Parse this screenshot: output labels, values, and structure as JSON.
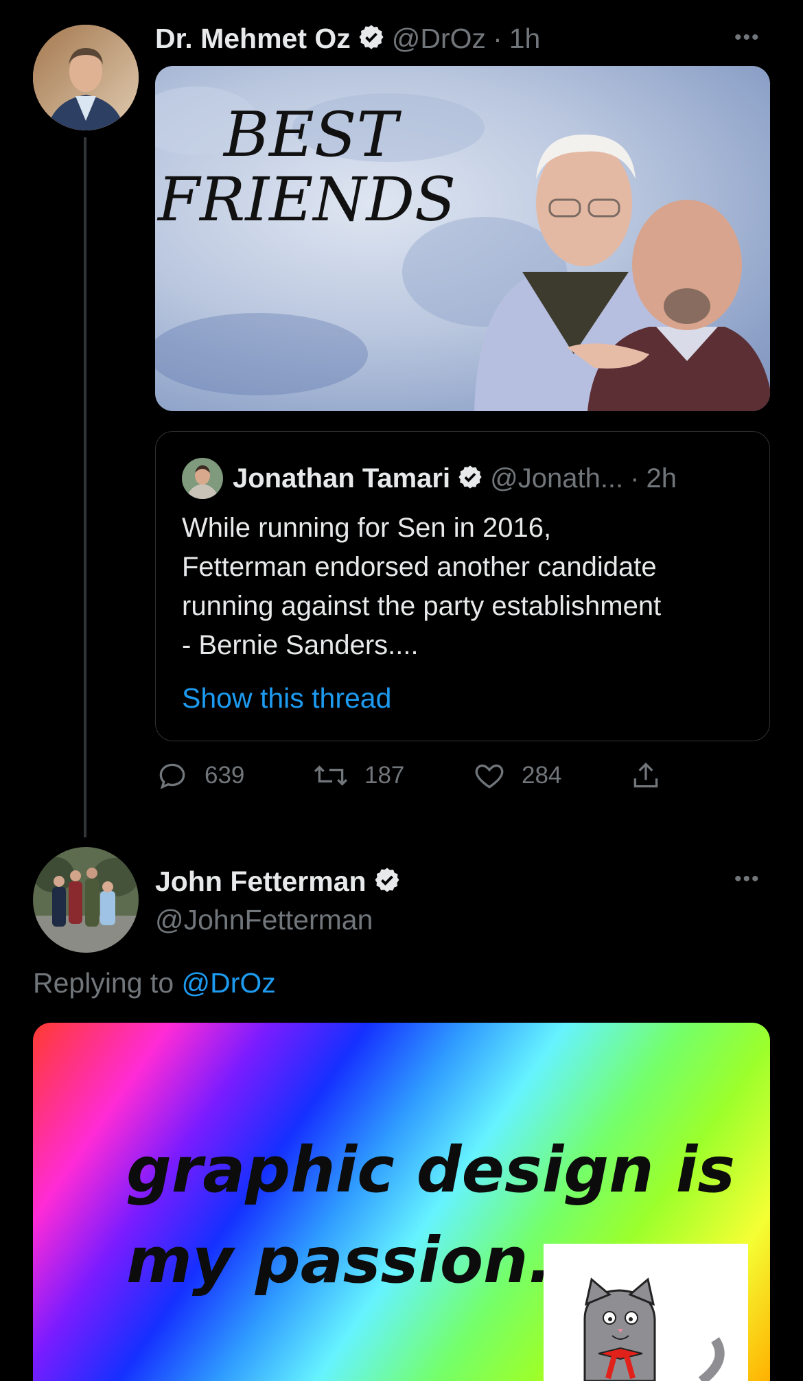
{
  "tweet1": {
    "author_name": "Dr. Mehmet Oz",
    "handle": "@DrOz",
    "separator": "·",
    "time": "1h",
    "more": "•••",
    "image": {
      "title_line1": "BEST",
      "title_line2": "FRIENDS"
    },
    "quote": {
      "author_name": "Jonathan Tamari",
      "handle": "@Jonath...",
      "separator": "·",
      "time": "2h",
      "lines": [
        "While running for Sen in 2016,",
        "Fetterman endorsed another candidate",
        "running against the party establishment",
        "- Bernie Sanders...."
      ],
      "show_thread": "Show this thread"
    },
    "actions": {
      "replies": "639",
      "retweets": "187",
      "likes": "284",
      "share_icon": "share-icon"
    }
  },
  "tweet2": {
    "author_name": "John Fetterman",
    "handle": "@JohnFetterman",
    "more": "•••",
    "replying_prefix": "Replying to",
    "replying_handle": "@DrOz",
    "image": {
      "line1": "graphic design is",
      "line2": "my passion."
    }
  },
  "colors": {
    "background": "#000000",
    "text": "#e7e9ea",
    "muted": "#71767b",
    "link": "#1d9bf0",
    "border": "#2f3336"
  }
}
